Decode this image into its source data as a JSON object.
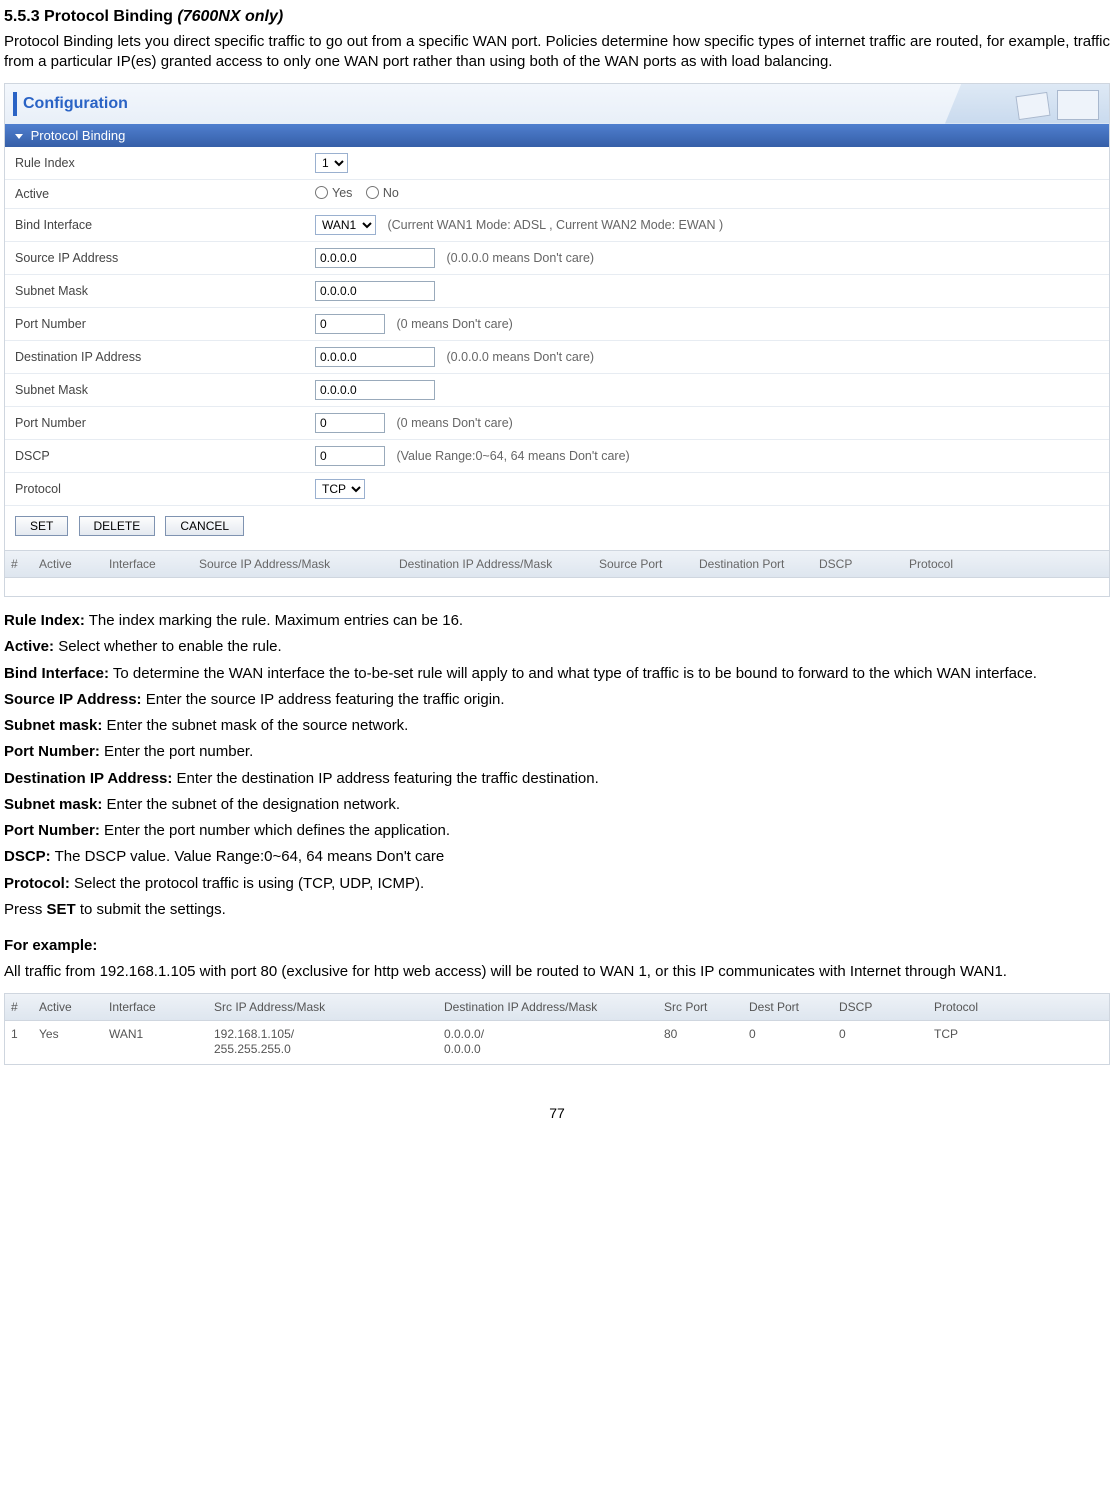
{
  "heading": {
    "number": "5.5.3",
    "title": "Protocol Binding",
    "note": "(7600NX only)"
  },
  "intro": "Protocol Binding lets you direct specific traffic to go out from a specific WAN port. Policies determine how specific types of internet traffic are routed, for example, traffic from a particular IP(es) granted access to only one WAN port rather than using both of the WAN ports as with load balancing.",
  "panel": {
    "header_title": "Configuration",
    "section_title": "Protocol Binding",
    "rows": {
      "rule_index": {
        "label": "Rule Index",
        "value": "1"
      },
      "active": {
        "label": "Active",
        "yes": "Yes",
        "no": "No"
      },
      "bind_interface": {
        "label": "Bind Interface",
        "value": "WAN1",
        "hint": "(Current WAN1 Mode: ADSL , Current WAN2 Mode: EWAN )"
      },
      "source_ip": {
        "label": "Source IP Address",
        "value": "0.0.0.0",
        "hint": "(0.0.0.0 means Don't care)"
      },
      "subnet_mask1": {
        "label": "Subnet Mask",
        "value": "0.0.0.0"
      },
      "port_number1": {
        "label": "Port Number",
        "value": "0",
        "hint": "(0 means Don't care)"
      },
      "dest_ip": {
        "label": "Destination IP Address",
        "value": "0.0.0.0",
        "hint": "(0.0.0.0 means Don't care)"
      },
      "subnet_mask2": {
        "label": "Subnet Mask",
        "value": "0.0.0.0"
      },
      "port_number2": {
        "label": "Port Number",
        "value": "0",
        "hint": "(0 means Don't care)"
      },
      "dscp": {
        "label": "DSCP",
        "value": "0",
        "hint": "(Value Range:0~64, 64 means Don't care)"
      },
      "protocol": {
        "label": "Protocol",
        "value": "TCP"
      }
    },
    "buttons": {
      "set": "SET",
      "delete": "DELETE",
      "cancel": "CANCEL"
    },
    "list_header": {
      "num": "#",
      "active": "Active",
      "interface": "Interface",
      "src": "Source IP Address/Mask",
      "dst": "Destination IP Address/Mask",
      "sport": "Source Port",
      "dport": "Destination Port",
      "dscp": "DSCP",
      "protocol": "Protocol"
    }
  },
  "descriptions": [
    {
      "term": "Rule Index:",
      "text": " The index marking the rule. Maximum entries can be 16."
    },
    {
      "term": "Active:",
      "text": " Select whether to enable the rule."
    },
    {
      "term": "Bind Interface:",
      "text": " To determine the WAN interface the to-be-set rule will apply to and what type of traffic is to be bound to forward to the which WAN interface."
    },
    {
      "term": "Source IP Address:",
      "text": " Enter the source IP address featuring the traffic origin."
    },
    {
      "term": "Subnet mask:",
      "text": " Enter the subnet mask of the source network."
    },
    {
      "term": "Port Number:",
      "text": " Enter the port number."
    },
    {
      "term": "Destination IP Address:",
      "text": " Enter the destination IP address featuring the traffic destination."
    },
    {
      "term": "Subnet mask:",
      "text": " Enter the subnet of the designation network."
    },
    {
      "term": "Port Number:",
      "text": " Enter the port number which defines the application."
    },
    {
      "term": "DSCP:",
      "text": " The DSCP value. Value Range:0~64, 64 means Don't care"
    },
    {
      "term": "Protocol:",
      "text": " Select the protocol traffic is using (TCP, UDP, ICMP)."
    }
  ],
  "press_set": {
    "prefix": "Press ",
    "bold": "SET",
    "suffix": " to submit the settings."
  },
  "example": {
    "heading": "For example:",
    "text": "All traffic from 192.168.1.105 with port 80 (exclusive for http web access) will be routed to WAN 1, or this IP communicates with Internet through WAN1.",
    "header": {
      "num": "#",
      "active": "Active",
      "interface": "Interface",
      "src": "Src IP Address/Mask",
      "dst": "Destination IP Address/Mask",
      "sport": "Src Port",
      "dport": "Dest Port",
      "dscp": "DSCP",
      "protocol": "Protocol"
    },
    "row": {
      "num": "1",
      "active": "Yes",
      "interface": "WAN1",
      "src": "192.168.1.105/\n255.255.255.0",
      "dst": "0.0.0.0/\n0.0.0.0",
      "sport": "80",
      "dport": "0",
      "dscp": "0",
      "protocol": "TCP"
    }
  },
  "page_number": "77"
}
